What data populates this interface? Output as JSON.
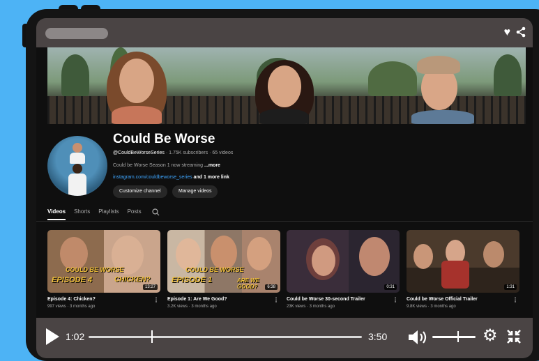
{
  "player_controls": {
    "current_time": "1:02",
    "duration": "3:50",
    "progress": 0.23,
    "volume": 0.58
  },
  "channel": {
    "name": "Could Be Worse",
    "handle": "@CouldBeWorseSeries",
    "meta": " · 1.75K subscribers · 65 videos",
    "description": "Could be Worse Season 1 now streaming ",
    "description_more": "...more",
    "link": "instagram.com/couldbeworse_series",
    "link_more": " and 1 more link",
    "customize_button": "Customize channel",
    "manage_button": "Manage videos"
  },
  "tabs": [
    {
      "label": "Videos",
      "active": true
    },
    {
      "label": "Shorts",
      "active": false
    },
    {
      "label": "Playlists",
      "active": false
    },
    {
      "label": "Posts",
      "active": false
    }
  ],
  "videos": [
    {
      "title": "Episode 4: Chicken?",
      "meta": "997 views · 3 months ago",
      "duration": "13:27",
      "overlay": [
        "COULD BE WORSE",
        "EPISODE 4",
        "CHICKEN?"
      ]
    },
    {
      "title": "Episode 1: Are We Good?",
      "meta": "3.2K views · 3 months ago",
      "duration": "6:38",
      "overlay": [
        "COULD BE WORSE",
        "EPISODE 1",
        "ARE WE GOOD?"
      ]
    },
    {
      "title": "Could be Worse 30-second Trailer",
      "meta": "23K views · 3 months ago",
      "duration": "0:31",
      "overlay": []
    },
    {
      "title": "Could be Worse Official Trailer",
      "meta": "9.8K views · 3 months ago",
      "duration": "1:31",
      "overlay": []
    }
  ],
  "colors": {
    "background": "#4db3f5",
    "overlay_bar": "#4a4444",
    "page": "#0f0f0f",
    "link": "#3ea6ff",
    "thumb_text": "#f2c13a"
  },
  "icons": [
    "heart-icon",
    "share-icon",
    "search-icon",
    "play-icon",
    "volume-icon",
    "gear-icon",
    "exit-fullscreen-icon",
    "more-vert-icon"
  ]
}
